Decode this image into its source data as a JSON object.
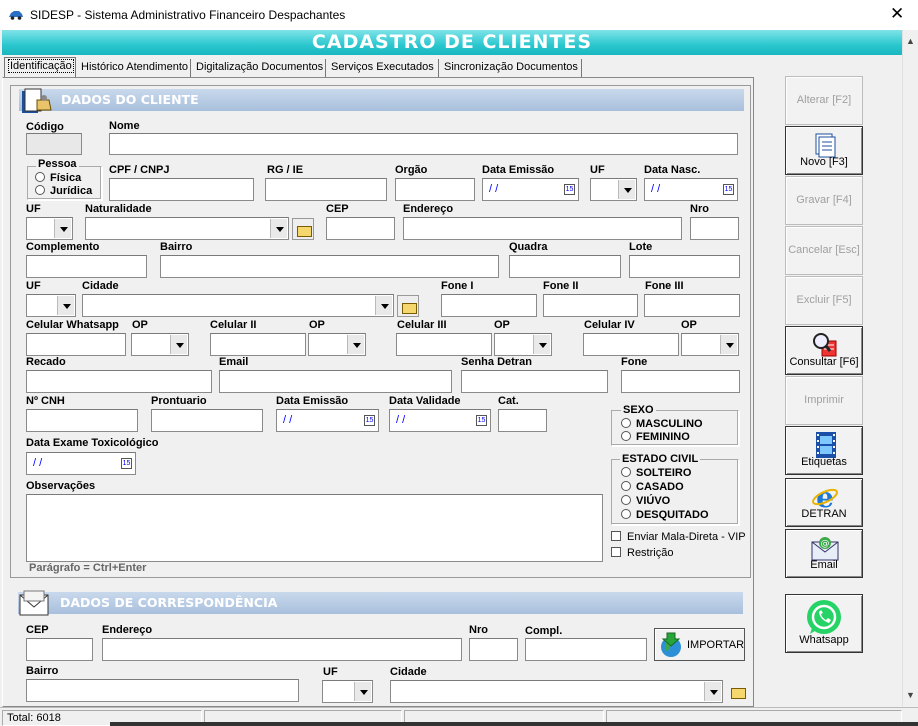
{
  "window": {
    "title": "SIDESP - Sistema Administrativo Financeiro Despachantes",
    "close": "✕"
  },
  "banner": "CADASTRO  DE  CLIENTES",
  "tabs": [
    "Identificação",
    "Histórico Atendimento",
    "Digitalização Documentos",
    "Serviços Executados",
    "Sincronização Documentos"
  ],
  "cliente": {
    "section": "DADOS DO CLIENTE",
    "codigo": "Código",
    "nome": "Nome",
    "pessoa": "Pessoa",
    "fisica": "Física",
    "juridica": "Jurídica",
    "cpf": "CPF / CNPJ",
    "rg": "RG / IE",
    "orgao": "Orgão",
    "data_emissao": "Data Emissão",
    "uf": "UF",
    "data_nasc": "Data Nasc.",
    "date_empty": "/ /",
    "cal": "15",
    "uf2": "UF",
    "naturalidade": "Naturalidade",
    "cep": "CEP",
    "endereco": "Endereço",
    "nro": "Nro",
    "complemento": "Complemento",
    "bairro": "Bairro",
    "quadra": "Quadra",
    "lote": "Lote",
    "uf3": "UF",
    "cidade": "Cidade",
    "fone1": "Fone I",
    "fone2": "Fone II",
    "fone3": "Fone III",
    "cel_whats": "Celular Whatsapp",
    "op": "OP",
    "cel2": "Celular II",
    "cel3": "Celular III",
    "cel4": "Celular IV",
    "recado": "Recado",
    "email": "Email",
    "senha_detran": "Senha Detran",
    "fone": "Fone",
    "cnh": "Nº CNH",
    "prontuario": "Prontuario",
    "data_emissao2": "Data Emissão",
    "data_validade": "Data Validade",
    "cat": "Cat.",
    "sexo": "SEXO",
    "masculino": "MASCULINO",
    "feminino": "FEMININO",
    "toxico": "Data Exame Toxicológico",
    "estado_civil": "ESTADO CIVIL",
    "solteiro": "SOLTEIRO",
    "casado": "CASADO",
    "viuvo": "VIÚVO",
    "desquitado": "DESQUITADO",
    "observacoes": "Observações",
    "paragrafo": "Parágrafo = Ctrl+Enter",
    "mala_direta": "Enviar Mala-Direta - VIP",
    "restricao": "Restrição"
  },
  "corresp": {
    "section": "DADOS DE CORRESPONDÊNCIA",
    "cep": "CEP",
    "endereco": "Endereço",
    "nro": "Nro",
    "compl": "Compl.",
    "importar": "IMPORTAR",
    "bairro": "Bairro",
    "uf": "UF",
    "cidade": "Cidade"
  },
  "sidebar": {
    "alterar": "Alterar  [F2]",
    "novo": "Novo  [F3]",
    "gravar": "Gravar  [F4]",
    "cancelar": "Cancelar  [Esc]",
    "excluir": "Excluir  [F5]",
    "consultar": "Consultar  [F6]",
    "imprimir": "Imprimir",
    "etiquetas": "Etiquetas",
    "detran": "DETRAN",
    "email": "Email",
    "whatsapp": "Whatsapp"
  },
  "status": {
    "total": "Total: 6018"
  },
  "colors": {
    "banner": "#2bc7cf",
    "section": "#a8bfdc",
    "date_text": "#0000ff"
  }
}
